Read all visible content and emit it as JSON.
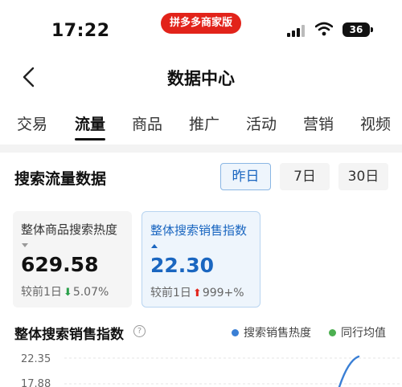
{
  "status_bar": {
    "time": "17:22",
    "app_badge": "拼多多商家版",
    "battery": "36"
  },
  "nav": {
    "title": "数据中心",
    "back_icon": "chevron-left-icon"
  },
  "tabs": [
    {
      "label": "交易",
      "active": false
    },
    {
      "label": "流量",
      "active": true
    },
    {
      "label": "商品",
      "active": false
    },
    {
      "label": "推广",
      "active": false
    },
    {
      "label": "活动",
      "active": false
    },
    {
      "label": "营销",
      "active": false
    },
    {
      "label": "视频",
      "active": false
    }
  ],
  "search_section": {
    "title": "搜索流量数据",
    "periods": [
      {
        "label": "昨日",
        "active": true
      },
      {
        "label": "7日",
        "active": false
      },
      {
        "label": "30日",
        "active": false
      }
    ]
  },
  "cards": [
    {
      "label": "整体商品搜索热度",
      "value": "629.58",
      "compare_prefix": "较前1日",
      "trend": "down",
      "compare_value": "5.07%",
      "selected": false
    },
    {
      "label": "整体搜索销售指数",
      "value": "22.30",
      "compare_prefix": "较前1日",
      "trend": "up",
      "compare_value": "999+%",
      "selected": true
    }
  ],
  "index_section": {
    "title": "整体搜索销售指数",
    "help_icon": "question-circle-icon",
    "legend": [
      {
        "label": "搜索销售热度",
        "color": "#3a7fd5"
      },
      {
        "label": "同行均值",
        "color": "#4caf50"
      }
    ]
  },
  "colors": {
    "accent": "#1a66c0",
    "brand_red": "#e2231a",
    "down_green": "#2aa04a"
  },
  "chart_data": {
    "type": "line",
    "y_ticks": [
      "22.35",
      "17.88"
    ],
    "series": [
      {
        "name": "搜索销售热度",
        "color": "#3a7fd5",
        "values": [
          22.35
        ]
      },
      {
        "name": "同行均值",
        "color": "#4caf50",
        "values": []
      }
    ],
    "ylim": [
      17.88,
      22.35
    ],
    "grid": true
  }
}
